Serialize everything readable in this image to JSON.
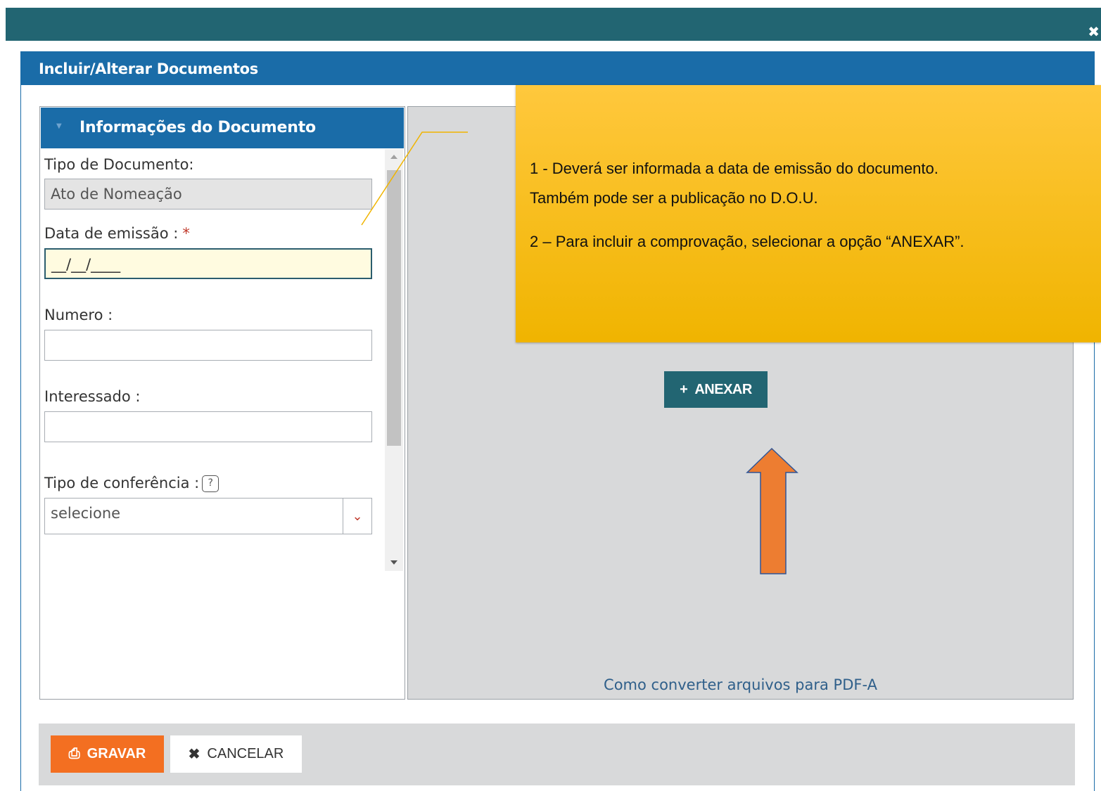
{
  "window": {
    "close_glyph": "✖"
  },
  "dialog": {
    "title": "Incluir/Alterar Documentos"
  },
  "section": {
    "title": "Informações do Documento"
  },
  "form": {
    "tipo_documento": {
      "label": "Tipo de Documento:",
      "value": "Ato de Nomeação"
    },
    "data_emissao": {
      "label": "Data de emissão :",
      "required_mark": "*",
      "value": "__/__/____"
    },
    "numero": {
      "label": "Numero :",
      "value": ""
    },
    "interessado": {
      "label": "Interessado :",
      "value": ""
    },
    "tipo_conferencia": {
      "label": "Tipo de conferência :",
      "value": "selecione"
    }
  },
  "attach": {
    "button_label": "ANEXAR",
    "button_icon": "+",
    "pdf_link": "Como converter arquivos para PDF-A"
  },
  "callout": {
    "line1": "1 - Deverá ser informada a data de emissão do documento.",
    "line2": "Também pode ser a publicação no D.O.U.",
    "line3": "2 – Para incluir a comprovação, selecionar a opção “ANEXAR”."
  },
  "footer": {
    "save_label": "GRAVAR",
    "save_icon": "⎙",
    "cancel_label": "CANCELAR",
    "cancel_icon": "✖"
  },
  "colors": {
    "topbar": "#226572",
    "header": "#1a6ca8",
    "save": "#f36f21",
    "callout": "#ffc83d",
    "arrow": "#ed7d31"
  }
}
